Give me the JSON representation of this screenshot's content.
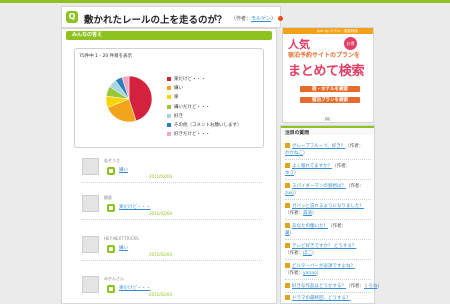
{
  "question": {
    "icon_letter": "Q",
    "title": "敷かれたレールの上を走るのが？",
    "meta_prefix": "（作者：",
    "author": "モルゲン",
    "meta_suffix": "）"
  },
  "answers_section": {
    "title": "みんなの答え"
  },
  "chart": {
    "header": "75件中 1 - 20 件目を表示"
  },
  "chart_data": {
    "type": "pie",
    "title": "",
    "categories": [
      "楽だけど・・・",
      "嫌い",
      "楽",
      "嫌いだけど・・・",
      "好き",
      "その他（コメントお願いします）",
      "好きだけど・・・"
    ],
    "values": [
      45,
      24,
      8,
      7,
      6,
      5,
      5
    ],
    "colors": [
      "#d4213d",
      "#f2a31c",
      "#f5d400",
      "#9ac73a",
      "#a6d6de",
      "#2b7fbf",
      "#f2a6c2"
    ],
    "legend_position": "right"
  },
  "answers": [
    {
      "user": "若ぞうさ",
      "label": "嫌い",
      "date": "2011/02/04"
    },
    {
      "user": "鋼鉄",
      "label": "楽だけど・・・",
      "date": "2011/02/04"
    },
    {
      "user": "HEY-NEXT-TRICKS",
      "label": "嫌い",
      "date": "2011/02/04"
    },
    {
      "user": "みかんさん",
      "label": "楽だけど・・・",
      "date": "2011/02/04"
    }
  ],
  "ad": {
    "top_text": "goo by ホテル・旅館検索",
    "ninki": "人気",
    "otoku": "お得",
    "line1": "宿泊予約サイトの",
    "line1_suffix": "プランを",
    "big": "まとめて検索",
    "btn1": "宿・ホテルを検索",
    "btn2": "宿泊プランを検索",
    "pr": "PR"
  },
  "sidebar": {
    "title": "注目の質問",
    "items": [
      {
        "q": "グレープフルーツ、好き？",
        "meta_prefix": "（作者：",
        "author": "わかねこ",
        "meta_suffix": "）"
      },
      {
        "q": "よく眠れてますか？",
        "meta_prefix": "（作者：",
        "author": "ゆう",
        "meta_suffix": "）"
      },
      {
        "q": "スパイダーマンの感想は？",
        "meta_prefix": "（作者：",
        "author": "zuki",
        "meta_suffix": "）"
      },
      {
        "q": "ガバッと訪れるようになりました！",
        "meta_prefix": "（作者：",
        "author": "森道",
        "meta_suffix": "）"
      },
      {
        "q": "あなたの働いた！",
        "meta_prefix": "（作者：",
        "author": "翼",
        "meta_suffix": "）"
      },
      {
        "q": "テレビ好きですか？ どうする？",
        "meta_prefix": "（作者：",
        "author": "ぽこ",
        "meta_suffix": "）"
      },
      {
        "q": "ビルターバーが必須ですよね？",
        "meta_prefix": "（作者：",
        "author": "yanao",
        "meta_suffix": "）"
      },
      {
        "q": "好きな作品はどうかする？",
        "meta_prefix": "（作者：",
        "author": "くろね",
        "meta_suffix": "）"
      },
      {
        "q": "ドラマの最終回、どうする？",
        "meta_prefix": "",
        "author": "",
        "meta_suffix": ""
      }
    ]
  }
}
